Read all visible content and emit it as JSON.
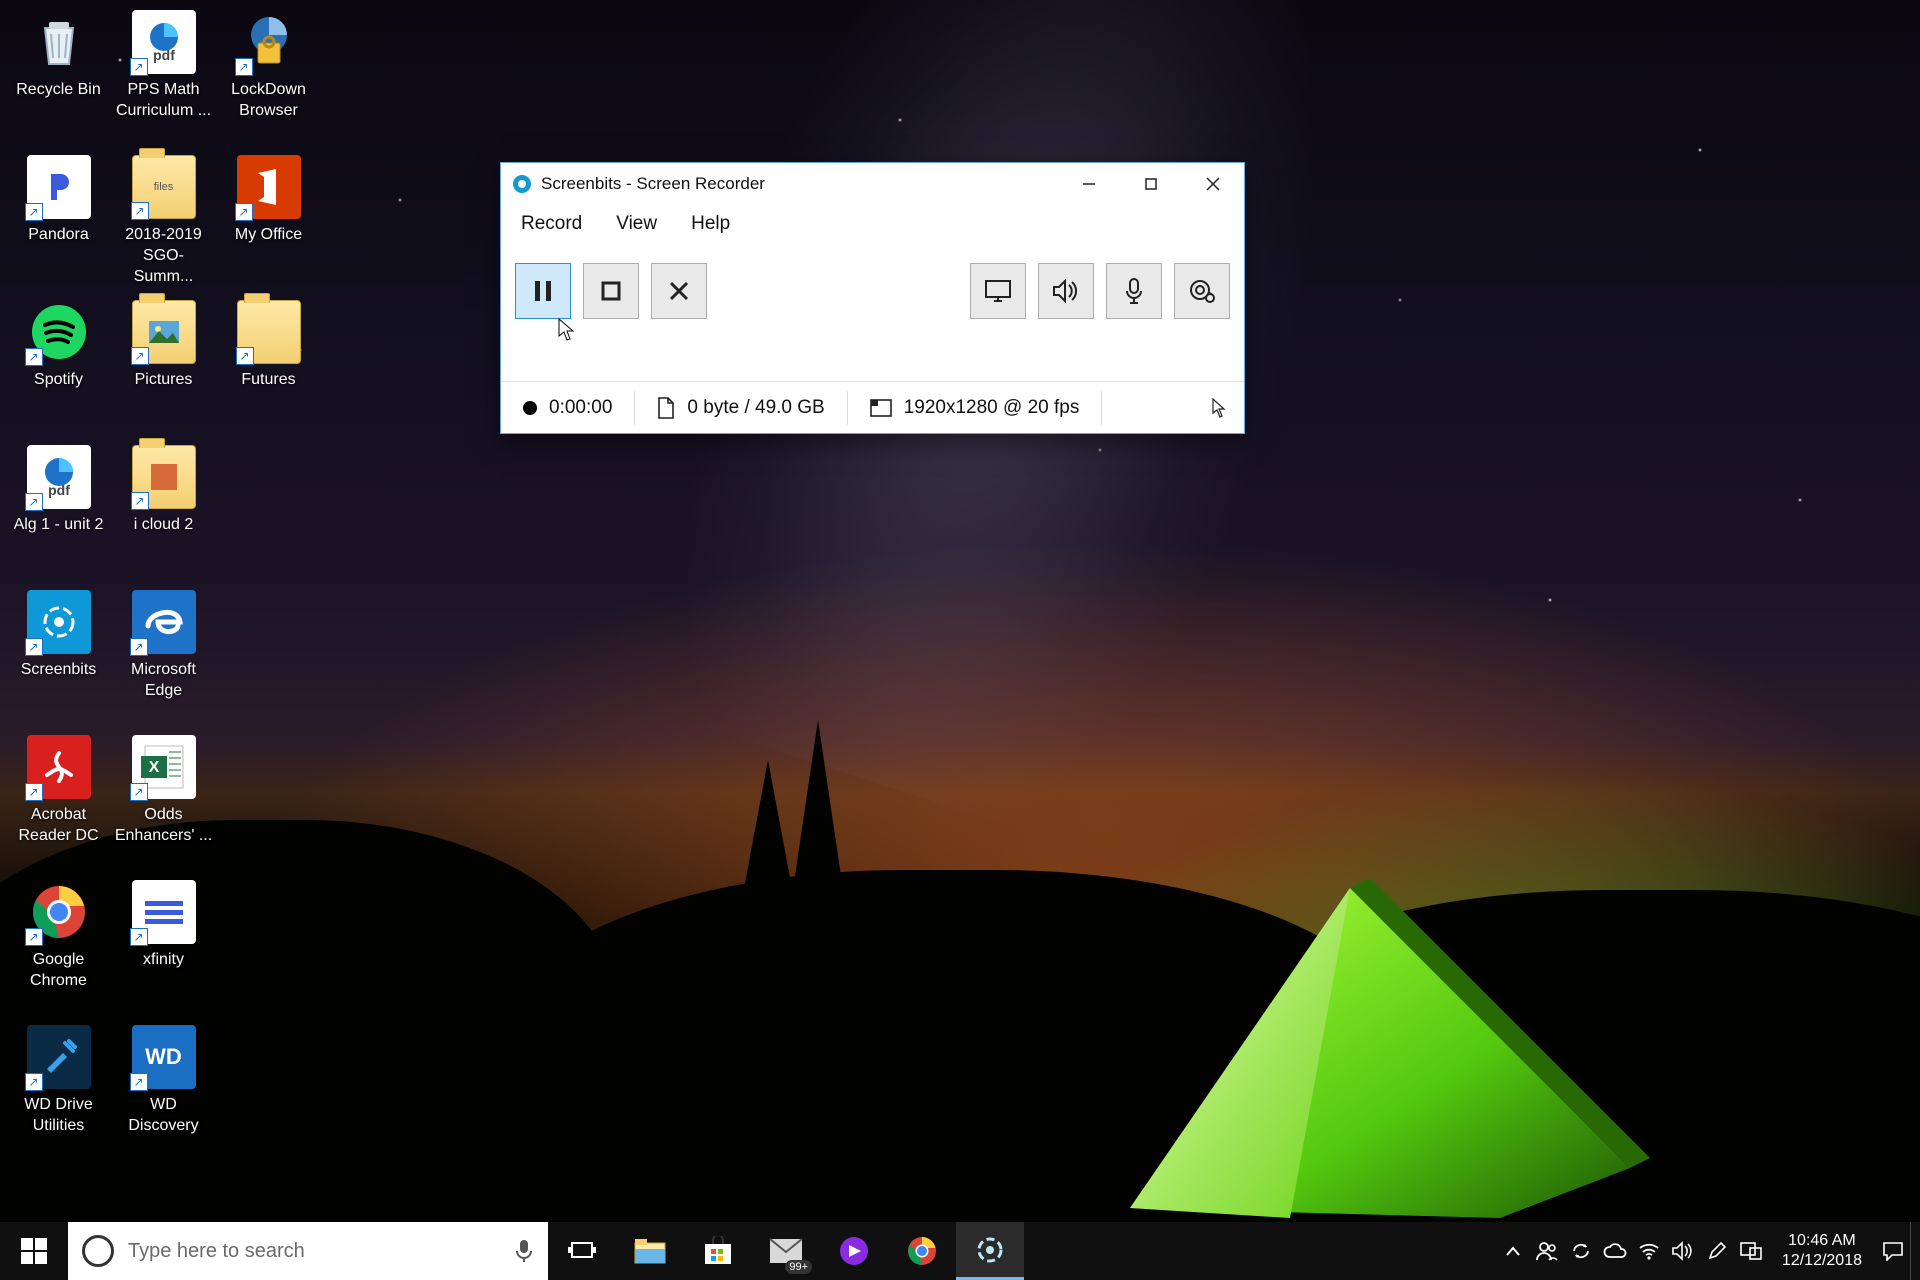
{
  "desktop_icons": [
    {
      "id": "recycle-bin",
      "label": "Recycle Bin"
    },
    {
      "id": "pps-math",
      "label": "PPS Math Curriculum ..."
    },
    {
      "id": "lockdown",
      "label": "LockDown Browser"
    },
    {
      "id": "pandora",
      "label": "Pandora"
    },
    {
      "id": "sgo",
      "label": "2018-2019 SGO-Summ..."
    },
    {
      "id": "myoffice",
      "label": "My Office"
    },
    {
      "id": "spotify",
      "label": "Spotify"
    },
    {
      "id": "pictures",
      "label": "Pictures"
    },
    {
      "id": "futures",
      "label": "Futures"
    },
    {
      "id": "alg1",
      "label": "Alg 1 - unit 2"
    },
    {
      "id": "icloud2",
      "label": "i cloud 2"
    },
    {
      "id": "blank1",
      "label": ""
    },
    {
      "id": "screenbits",
      "label": "Screenbits"
    },
    {
      "id": "edge",
      "label": "Microsoft Edge"
    },
    {
      "id": "blank2",
      "label": ""
    },
    {
      "id": "acrobat",
      "label": "Acrobat Reader DC"
    },
    {
      "id": "odds",
      "label": "Odds Enhancers' ..."
    },
    {
      "id": "blank3",
      "label": ""
    },
    {
      "id": "chrome",
      "label": "Google Chrome"
    },
    {
      "id": "xfinity",
      "label": "xfinity"
    },
    {
      "id": "blank4",
      "label": ""
    },
    {
      "id": "wddrive",
      "label": "WD Drive Utilities"
    },
    {
      "id": "wddisc",
      "label": "WD Discovery"
    }
  ],
  "window": {
    "title": "Screenbits - Screen Recorder",
    "menus": {
      "record": "Record",
      "view": "View",
      "help": "Help"
    },
    "status": {
      "timer": "0:00:00",
      "filesize": "0 byte / 49.0 GB",
      "resolution": "1920x1280 @ 20 fps"
    }
  },
  "taskbar": {
    "search_placeholder": "Type here to search",
    "mail_badge": "99+",
    "time": "10:46 AM",
    "date": "12/12/2018"
  }
}
